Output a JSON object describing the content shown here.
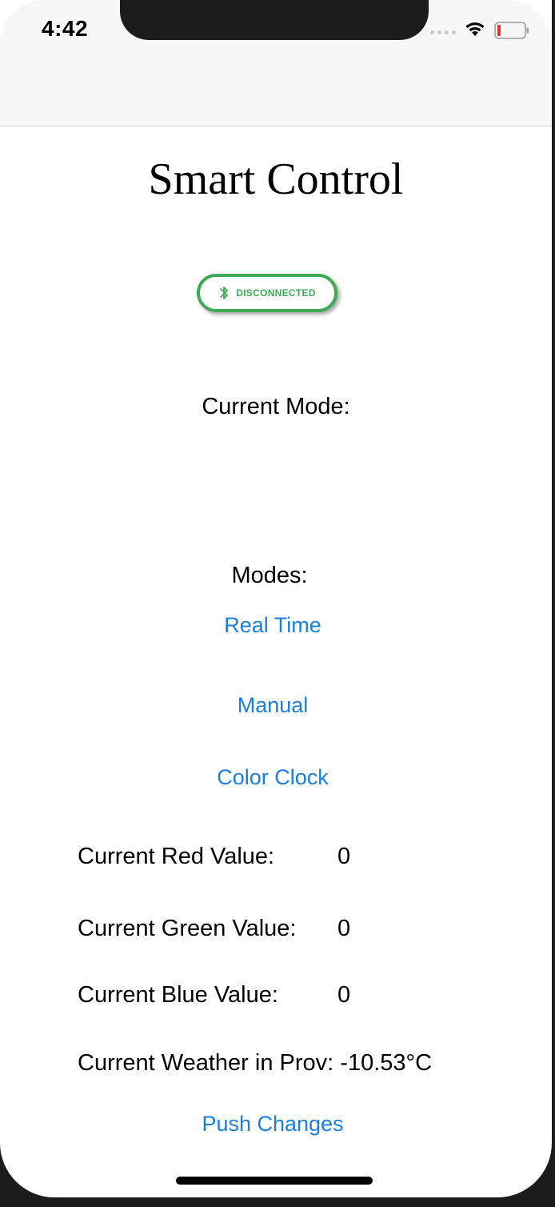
{
  "status_bar": {
    "time": "4:42"
  },
  "header": {
    "title": "Smart Control"
  },
  "connection": {
    "status_label": "DISCONNECTED",
    "icon": "bluetooth-icon",
    "color": "#3faa55"
  },
  "current_mode": {
    "label": "Current Mode:",
    "value": ""
  },
  "modes": {
    "label": "Modes:",
    "items": [
      "Real Time",
      "Manual",
      "Color Clock"
    ]
  },
  "values": {
    "red_label": "Current Red Value:",
    "red_value": "0",
    "green_label": "Current Green Value:",
    "green_value": "0",
    "blue_label": "Current Blue Value:",
    "blue_value": "0"
  },
  "weather": {
    "label": "Current Weather in Prov:",
    "value": "-10.53°C"
  },
  "actions": {
    "push_label": "Push Changes"
  },
  "colors": {
    "link": "#1a7fe0",
    "accent": "#3faa55"
  }
}
